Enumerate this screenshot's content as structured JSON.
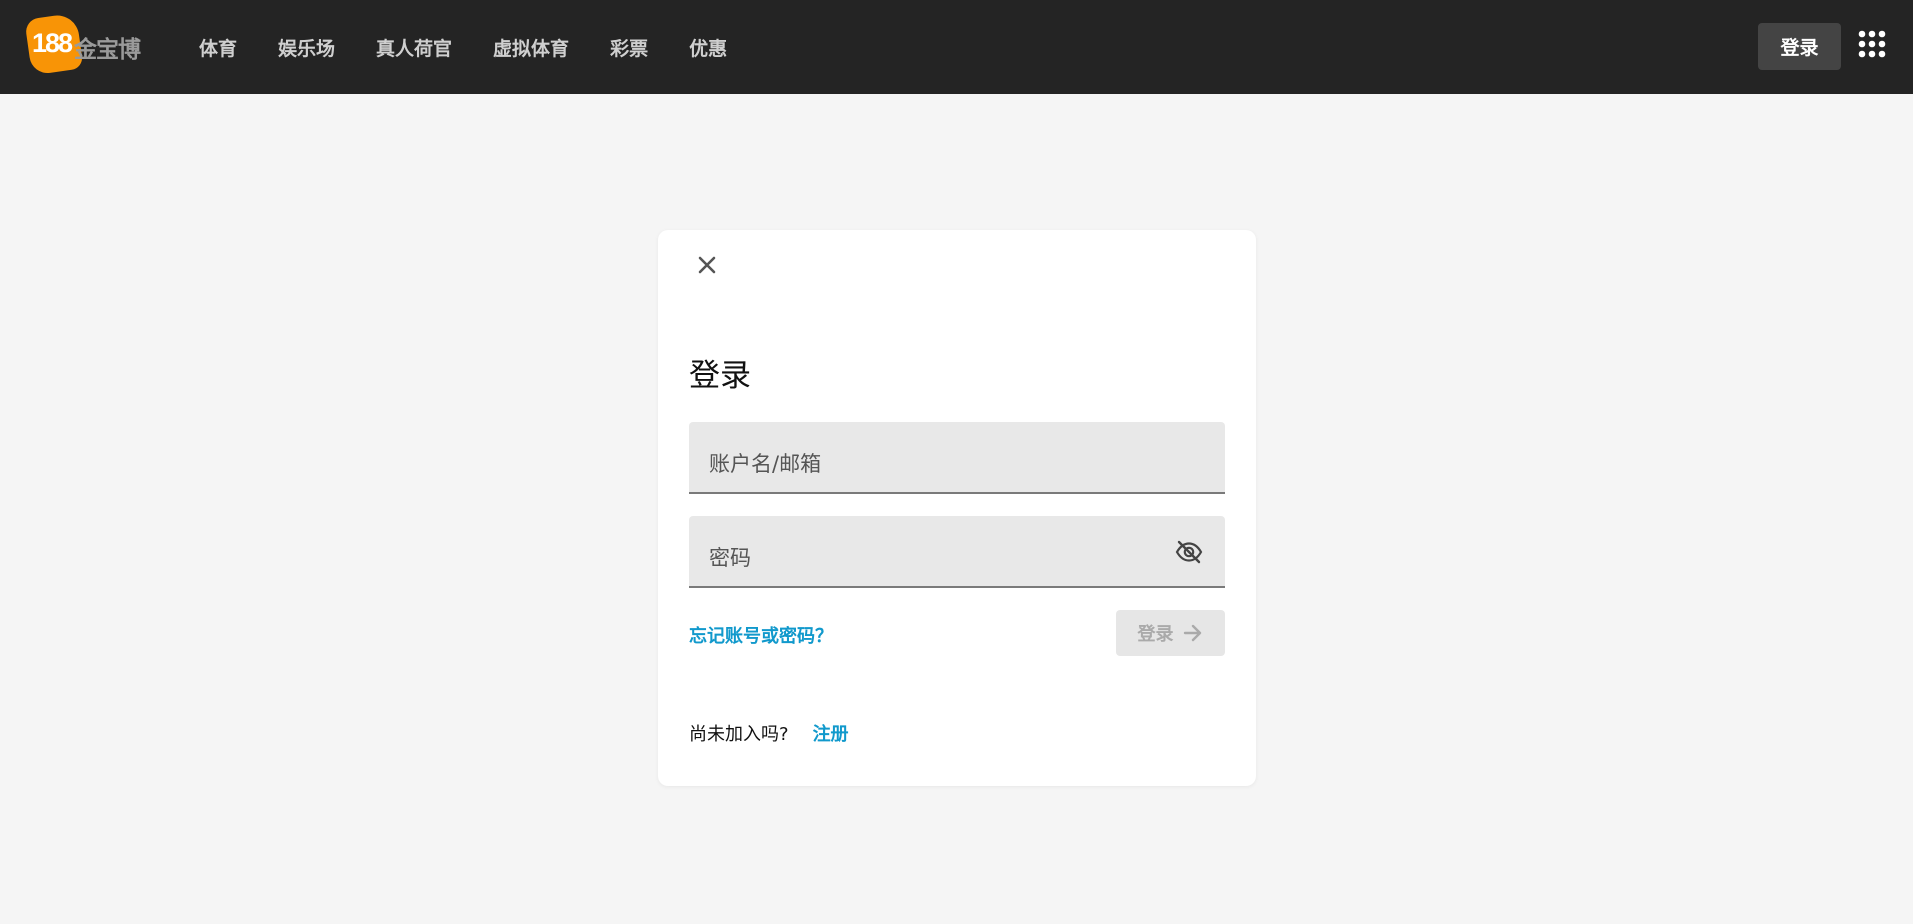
{
  "header": {
    "logo_number": "188",
    "logo_text": "金宝博",
    "nav": [
      {
        "label": "体育"
      },
      {
        "label": "娱乐场"
      },
      {
        "label": "真人荷官"
      },
      {
        "label": "虚拟体育"
      },
      {
        "label": "彩票"
      },
      {
        "label": "优惠"
      }
    ],
    "login_label": "登录"
  },
  "login_card": {
    "title": "登录",
    "username_placeholder": "账户名/邮箱",
    "password_placeholder": "密码",
    "forgot_label": "忘记账号或密码？",
    "submit_label": "登录",
    "signup_prompt": "尚未加入吗?",
    "signup_label": "注册"
  },
  "colors": {
    "header_bg": "#242424",
    "logo_orange": "#f89406",
    "link_blue": "#1199cc",
    "page_bg": "#f5f5f5"
  },
  "icons": [
    "close-icon",
    "eye-off-icon",
    "arrow-right-icon",
    "apps-grid-icon"
  ]
}
